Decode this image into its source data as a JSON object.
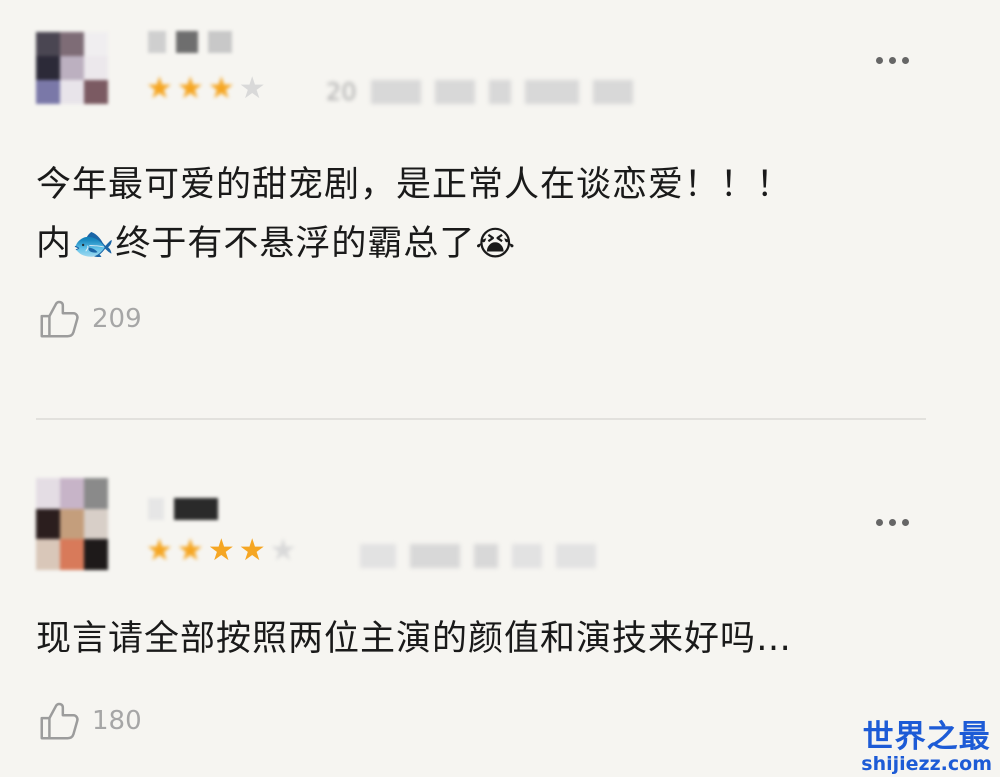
{
  "comments": [
    {
      "rating": 3,
      "date_prefix": "20",
      "text_line1": "今年最可爱的甜宠剧，是正常人在谈恋爱！！！",
      "text_line2_before": "内",
      "text_line2_emoji1": "🐟",
      "text_line2_after": "终于有不悬浮的霸总了",
      "text_line2_emoji2": "😭",
      "likes": "209"
    },
    {
      "rating": 3.5,
      "text": "现言请全部按照两位主演的颜值和演技来好吗…",
      "likes": "180"
    }
  ],
  "watermark": {
    "title": "世界之最",
    "url": "shijiezz.com"
  },
  "colors": {
    "star": "#f5a623",
    "star_off": "#d9d9d9",
    "watermark": "#1d5bd6"
  },
  "icons": {
    "more": "more-options-icon",
    "like": "thumbs-up-icon"
  }
}
